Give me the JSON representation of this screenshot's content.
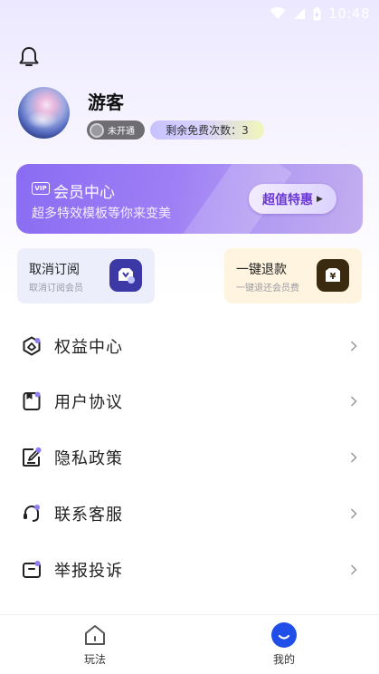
{
  "status_bar": {
    "time": "10:48"
  },
  "profile": {
    "username": "游客",
    "vip_badge": "未开通",
    "free_count_text": "剩余免费次数：3"
  },
  "banner": {
    "vip_tag": "VIP",
    "title": "会员中心",
    "subtitle": "超多特效模板等你来变美",
    "cta_label": "超值特惠"
  },
  "cards": [
    {
      "title": "取消订阅",
      "subtitle": "取消订阅会员"
    },
    {
      "title": "一键退款",
      "subtitle": "一键退还会员费"
    }
  ],
  "menu": [
    {
      "label": "权益中心",
      "icon": "benefits-icon"
    },
    {
      "label": "用户协议",
      "icon": "agreement-icon"
    },
    {
      "label": "隐私政策",
      "icon": "privacy-icon"
    },
    {
      "label": "联系客服",
      "icon": "headset-icon"
    },
    {
      "label": "举报投诉",
      "icon": "report-icon"
    }
  ],
  "bottom_nav": [
    {
      "label": "玩法",
      "icon": "home-icon"
    },
    {
      "label": "我的",
      "icon": "profile-icon",
      "active": true
    }
  ],
  "colors": {
    "accent": "#8a6cf3",
    "nav_active": "#1f4fe8"
  }
}
